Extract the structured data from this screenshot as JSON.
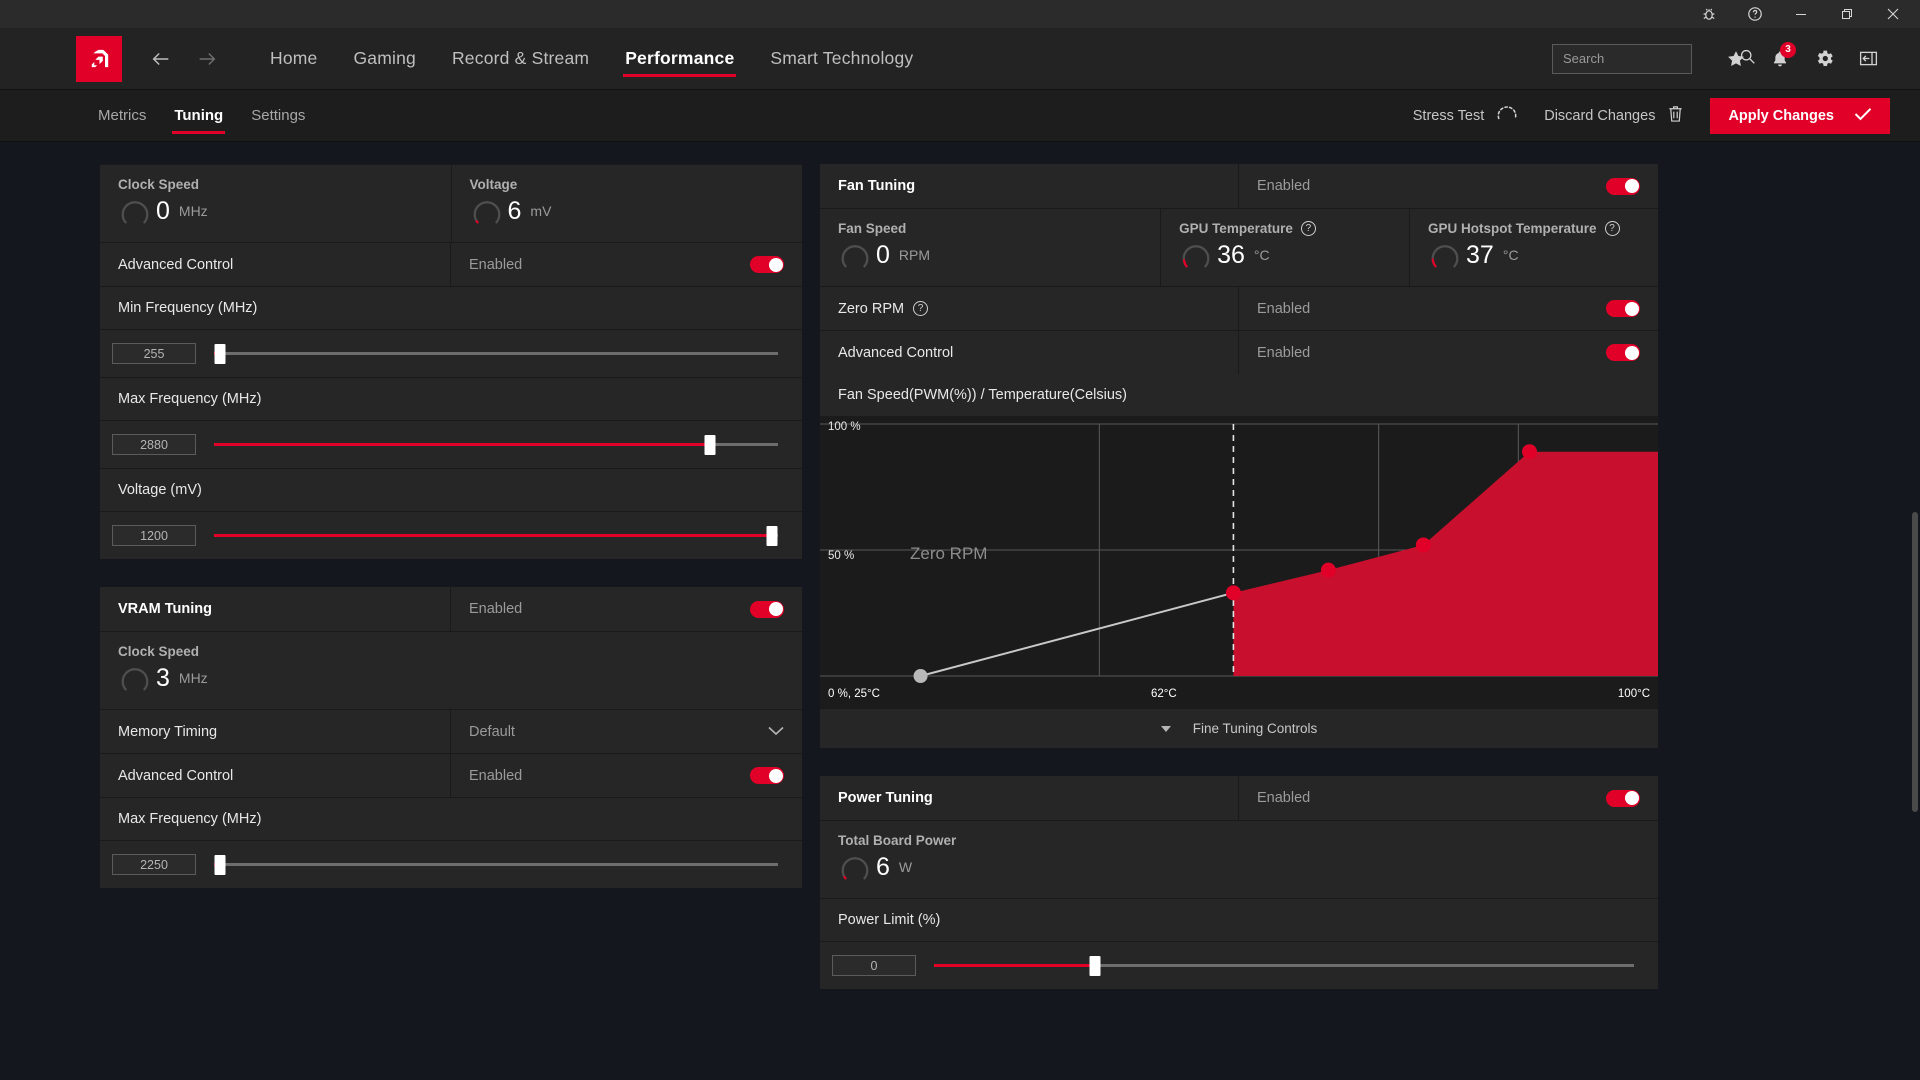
{
  "window": {
    "titlebar_icons": [
      "bug-icon",
      "help-icon",
      "minimize-icon",
      "restore-icon",
      "close-icon"
    ]
  },
  "nav": {
    "logo": "amd-logo",
    "back": "back-arrow-icon",
    "forward": "forward-arrow-icon",
    "items": [
      {
        "label": "Home",
        "active": false
      },
      {
        "label": "Gaming",
        "active": false
      },
      {
        "label": "Record & Stream",
        "active": false
      },
      {
        "label": "Performance",
        "active": true
      },
      {
        "label": "Smart Technology",
        "active": false
      }
    ],
    "search": {
      "placeholder": "Search",
      "value": ""
    },
    "notification_count": "3"
  },
  "subnav": {
    "tabs": [
      {
        "label": "Metrics",
        "active": false
      },
      {
        "label": "Tuning",
        "active": true
      },
      {
        "label": "Settings",
        "active": false
      }
    ],
    "stress_test_label": "Stress Test",
    "discard_label": "Discard Changes",
    "apply_label": "Apply Changes"
  },
  "gpu_tuning": {
    "metrics": [
      {
        "title": "Clock Speed",
        "value": "0",
        "unit": "MHz",
        "gauge_pct": 0
      },
      {
        "title": "Voltage",
        "value": "6",
        "unit": "mV",
        "gauge_pct": 3
      }
    ],
    "advanced_control": {
      "label": "Advanced Control",
      "state": "Enabled",
      "on": true
    },
    "sliders": [
      {
        "label": "Min Frequency (MHz)",
        "value": "255",
        "pct": 1
      },
      {
        "label": "Max Frequency (MHz)",
        "value": "2880",
        "pct": 88
      },
      {
        "label": "Voltage (mV)",
        "value": "1200",
        "pct": 99
      }
    ]
  },
  "vram_tuning": {
    "title": "VRAM Tuning",
    "state": "Enabled",
    "on": true,
    "metric": {
      "title": "Clock Speed",
      "value": "3",
      "unit": "MHz",
      "gauge_pct": 0
    },
    "memory_timing": {
      "label": "Memory Timing",
      "value": "Default"
    },
    "advanced_control": {
      "label": "Advanced Control",
      "state": "Enabled",
      "on": true
    },
    "slider": {
      "label": "Max Frequency (MHz)",
      "value": "2250",
      "pct": 1
    }
  },
  "fan_tuning": {
    "title": "Fan Tuning",
    "state": "Enabled",
    "on": true,
    "metrics": [
      {
        "title": "Fan Speed",
        "value": "0",
        "unit": "RPM",
        "gauge_pct": 0,
        "help": false
      },
      {
        "title": "GPU Temperature",
        "value": "36",
        "unit": "°C",
        "gauge_pct": 22,
        "help": true
      },
      {
        "title": "GPU Hotspot Temperature",
        "value": "37",
        "unit": "°C",
        "gauge_pct": 24,
        "help": true
      }
    ],
    "zero_rpm": {
      "label": "Zero RPM",
      "state": "Enabled",
      "on": true,
      "help": true
    },
    "advanced_control": {
      "label": "Advanced Control",
      "state": "Enabled",
      "on": true
    },
    "chart_title": "Fan Speed(PWM(%)) / Temperature(Celsius)",
    "fine_tuning_label": "Fine Tuning Controls"
  },
  "power_tuning": {
    "title": "Power Tuning",
    "state": "Enabled",
    "on": true,
    "metric": {
      "title": "Total Board Power",
      "value": "6",
      "unit": "W",
      "gauge_pct": 4
    },
    "slider": {
      "label": "Power Limit (%)",
      "value": "0",
      "pct": 23
    }
  },
  "chart_data": {
    "type": "line",
    "title": "Fan Speed(PWM(%)) / Temperature(Celsius)",
    "xlabel": "Temperature(Celsius)",
    "ylabel": "Fan Speed(PWM(%))",
    "xlim": [
      25,
      100
    ],
    "ylim": [
      0,
      100
    ],
    "y_ticks": [
      "0 %, 25°C",
      "50 %",
      "100 %"
    ],
    "x_ticks": [
      "0 %, 25°C",
      "62°C",
      "100°C"
    ],
    "grid": true,
    "zero_rpm_label": "Zero RPM",
    "zero_rpm_threshold_c": 62,
    "series": [
      {
        "name": "Zero RPM segment",
        "color": "#c9c9c9",
        "points": [
          {
            "x": 34,
            "y": 0
          },
          {
            "x": 62,
            "y": 33
          }
        ]
      },
      {
        "name": "Fan Curve",
        "color": "#c8102e",
        "points": [
          {
            "x": 62,
            "y": 33
          },
          {
            "x": 70.5,
            "y": 42
          },
          {
            "x": 79,
            "y": 52
          },
          {
            "x": 88.5,
            "y": 89
          },
          {
            "x": 100,
            "y": 89
          }
        ]
      }
    ]
  }
}
